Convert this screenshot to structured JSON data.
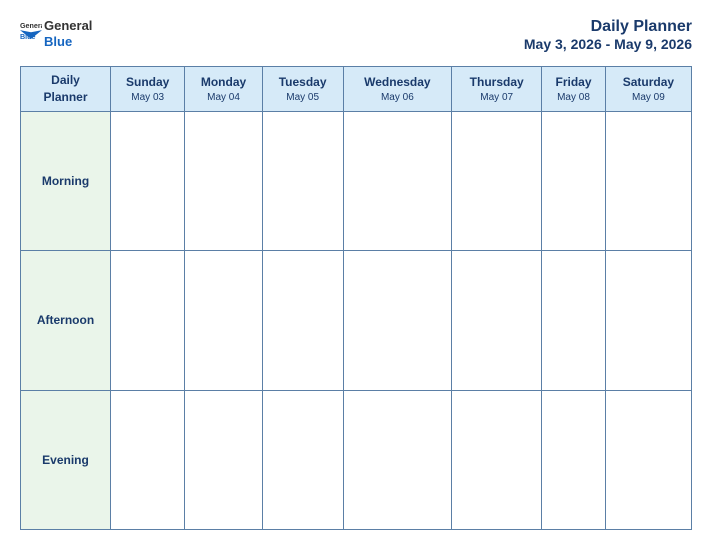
{
  "header": {
    "logo": {
      "general": "General",
      "blue": "Blue"
    },
    "title": "Daily Planner",
    "date_range": "May 3, 2026 - May 9, 2026"
  },
  "table": {
    "header_first_cell": [
      "Daily",
      "Planner"
    ],
    "days": [
      {
        "name": "Sunday",
        "date": "May 03"
      },
      {
        "name": "Monday",
        "date": "May 04"
      },
      {
        "name": "Tuesday",
        "date": "May 05"
      },
      {
        "name": "Wednesday",
        "date": "May 06"
      },
      {
        "name": "Thursday",
        "date": "May 07"
      },
      {
        "name": "Friday",
        "date": "May 08"
      },
      {
        "name": "Saturday",
        "date": "May 09"
      }
    ],
    "rows": [
      {
        "label": "Morning"
      },
      {
        "label": "Afternoon"
      },
      {
        "label": "Evening"
      }
    ]
  }
}
